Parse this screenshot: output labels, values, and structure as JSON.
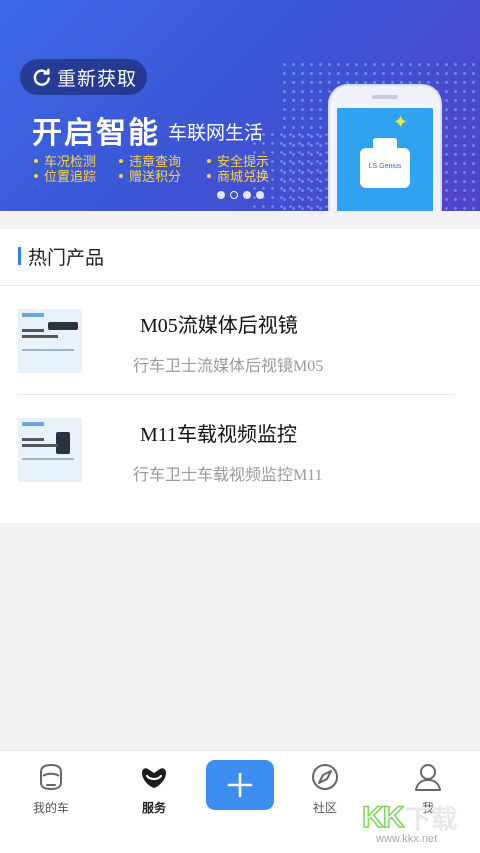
{
  "banner": {
    "refresh_label": "重新获取",
    "headline": "开启智能",
    "subtitle": "车联网生活",
    "features": [
      "车况检测",
      "违章查询",
      "安全提示",
      "位置追踪",
      "赠送积分",
      "商城兑换"
    ],
    "device_label": "LS Genius",
    "page_count": 4,
    "active_page": 2
  },
  "section": {
    "title": "热门产品",
    "products": [
      {
        "name": "M05流媒体后视镜",
        "desc": "行车卫士流媒体后视镜M05"
      },
      {
        "name": "M11车载视频监控",
        "desc": "行车卫士车载视频监控M11"
      }
    ]
  },
  "tabbar": {
    "items": [
      {
        "label": "我的车",
        "icon": "car-face-icon"
      },
      {
        "label": "服务",
        "icon": "service-icon",
        "active": true
      },
      {
        "label": "社区",
        "icon": "compass-icon"
      },
      {
        "label": "我",
        "icon": "person-icon"
      }
    ],
    "add_icon": "plus-icon"
  },
  "watermark": {
    "logo": "KK",
    "logo_suffix": "下载",
    "url": "www.kkx.net"
  },
  "colors": {
    "accent": "#3c8ff0",
    "banner_start": "#3e68e6",
    "banner_end": "#5342c8",
    "feature_text": "#ffd43a"
  }
}
